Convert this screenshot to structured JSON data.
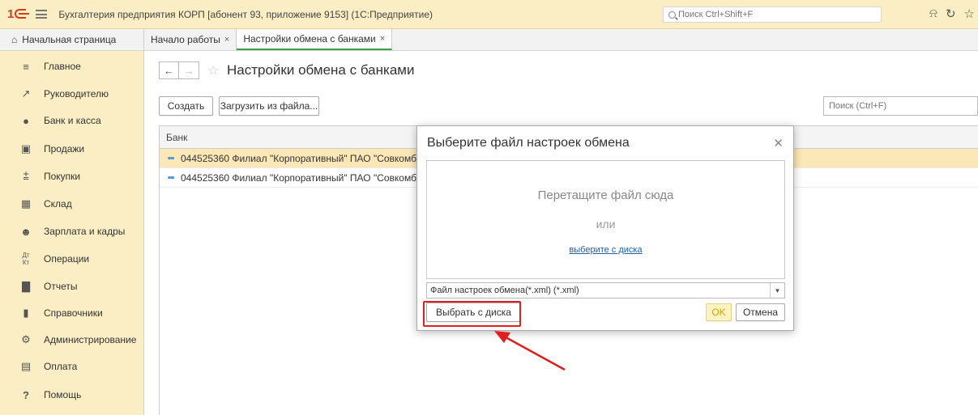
{
  "titlebar": {
    "title": "Бухгалтерия предприятия КОРП [абонент 93, приложение 9153]  (1С:Предприятие)",
    "logo_text": "1",
    "search_placeholder": "Поиск Ctrl+Shift+F"
  },
  "tabs": {
    "home": "Начальная страница",
    "items": [
      {
        "label": "Начало работы"
      },
      {
        "label": "Настройки обмена с банками"
      }
    ],
    "close_glyph": "×"
  },
  "sidebar": {
    "items": [
      {
        "label": "Главное",
        "icon": "menu-icon"
      },
      {
        "label": "Руководителю",
        "icon": "trend-icon"
      },
      {
        "label": "Банк и касса",
        "icon": "bank-icon"
      },
      {
        "label": "Продажи",
        "icon": "bag-icon"
      },
      {
        "label": "Покупки",
        "icon": "cart-icon"
      },
      {
        "label": "Склад",
        "icon": "warehouse-icon"
      },
      {
        "label": "Зарплата и кадры",
        "icon": "person-icon"
      },
      {
        "label": "Операции",
        "icon": "dt-kt-icon"
      },
      {
        "label": "Отчеты",
        "icon": "bars-icon"
      },
      {
        "label": "Справочники",
        "icon": "book-icon"
      },
      {
        "label": "Администрирование",
        "icon": "gear-icon"
      },
      {
        "label": "Оплата",
        "icon": "payment-icon"
      },
      {
        "label": "Помощь",
        "icon": "help-icon"
      }
    ]
  },
  "main": {
    "title": "Настройки обмена с банками",
    "create_label": "Создать",
    "load_label": "Загрузить из файла...",
    "search_placeholder": "Поиск (Ctrl+F)",
    "table": {
      "header": "Банк",
      "rows": [
        "044525360 Филиал \"Корпоративный\" ПАО \"Совкомбанк\"",
        "044525360 Филиал \"Корпоративный\" ПАО \"Совкомбанк\""
      ]
    }
  },
  "modal": {
    "title": "Выберите файл настроек обмена",
    "drop_text": "Перетащите файл сюда",
    "or_text": "или",
    "choose_link": "выберите с диска",
    "filter": "Файл настроек обмена(*.xml) (*.xml)",
    "choose_button": "Выбрать с диска",
    "ok_label": "OK",
    "cancel_label": "Отмена"
  },
  "colors": {
    "accent_yellow": "#fbeec4",
    "highlight_red": "#e02020",
    "active_tab_green": "#3c9d47",
    "link_blue": "#1b5fb0"
  }
}
